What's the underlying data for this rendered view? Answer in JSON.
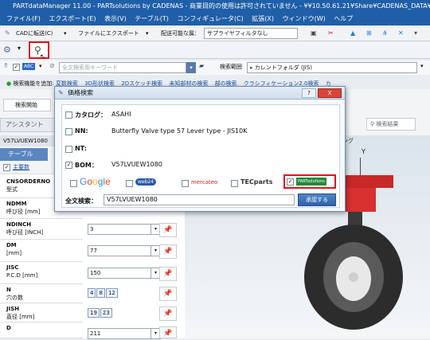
{
  "window": {
    "title": "PARTdataManager 11.00 - PARTsolutions by CADENAS - 商業目的の使用は許可されていません - ¥¥10.50.61.21¥Share¥CADENAS_DATA¥w2c_data"
  },
  "menu": [
    "ファイル(F)",
    "エクスポート(E)",
    "表示(V)",
    "テーブル(T)",
    "コンフィギュレータ(C)",
    "拡張(X)",
    "ウィンドウ(W)",
    "ヘルプ"
  ],
  "toolbar": {
    "cad_transfer": "CADに転送(C)",
    "export_to_file": "ファイルにエクスポート",
    "availability_label": "配送可能な属：",
    "supplier_filter": "サプライヤフィルタなし"
  },
  "search": {
    "abc_badge": "ABC",
    "fulltext_placeholder": "全文検索用キーワード",
    "scope_label": "検索範囲",
    "scope_value": "カレントフォルダ (JIS)"
  },
  "hints": {
    "add_label": "検索機能を追加:",
    "links": [
      "変数検索",
      "3D形状検索",
      "2Dスケッチ検索",
      "未知部材の検索",
      "部の検索",
      "クラシフィケーション2.0検索",
      "カ"
    ]
  },
  "left": {
    "search_start": "検索開始",
    "assistant_tab": "アシスタント",
    "part_header": "V57LVUEW1080",
    "table_tab": "テーブル",
    "main_var": "主要数",
    "properties": [
      {
        "code": "CNSORDERNO",
        "name": "型式",
        "value": ""
      },
      {
        "code": "NDMM",
        "name": "呼び径 [mm]",
        "value": ""
      },
      {
        "code": "NDINCH",
        "name": "呼び径 [INCH]",
        "value": "3"
      },
      {
        "code": "DM",
        "name": "[mm]",
        "value": "77"
      },
      {
        "code": "JISC",
        "name": "P.C.D [mm]",
        "value": "150"
      },
      {
        "code": "N",
        "name": "穴の数",
        "chips": [
          "4",
          "8",
          "12"
        ]
      },
      {
        "code": "JISH",
        "name": "直径 [mm]",
        "chips": [
          "19",
          "23"
        ]
      },
      {
        "code": "D",
        "name": "",
        "value": "211"
      }
    ]
  },
  "right": {
    "search_button": "検索結果",
    "viewer_label": "ング",
    "axis_y": "Y"
  },
  "dialog": {
    "title": "価格検索",
    "help": "?",
    "close": "X",
    "rows": [
      {
        "label": "カタログ：",
        "value": "ASAHI",
        "checked": false
      },
      {
        "label": "NN:",
        "value": "Butterfly Valve type 57 Lever type - JIS10K",
        "checked": false
      },
      {
        "label": "NT:",
        "value": "",
        "checked": false
      },
      {
        "label": "BOM：",
        "value": "V57LVUEW1080",
        "checked": true
      }
    ],
    "providers": {
      "google": [
        "G",
        "o",
        "o",
        "g",
        "l",
        "e"
      ],
      "google_colors": [
        "#4285f4",
        "#ea4335",
        "#fbbc05",
        "#4285f4",
        "#34a853",
        "#ea4335"
      ],
      "web24": "web24",
      "mercateo": "mercateo",
      "tecparts": "TECparts",
      "partsolutions": "PARTsolutions"
    },
    "fulltext_label": "全文検索：",
    "fulltext_value": "V57LVUEW1080",
    "execute_button": "承認する"
  }
}
